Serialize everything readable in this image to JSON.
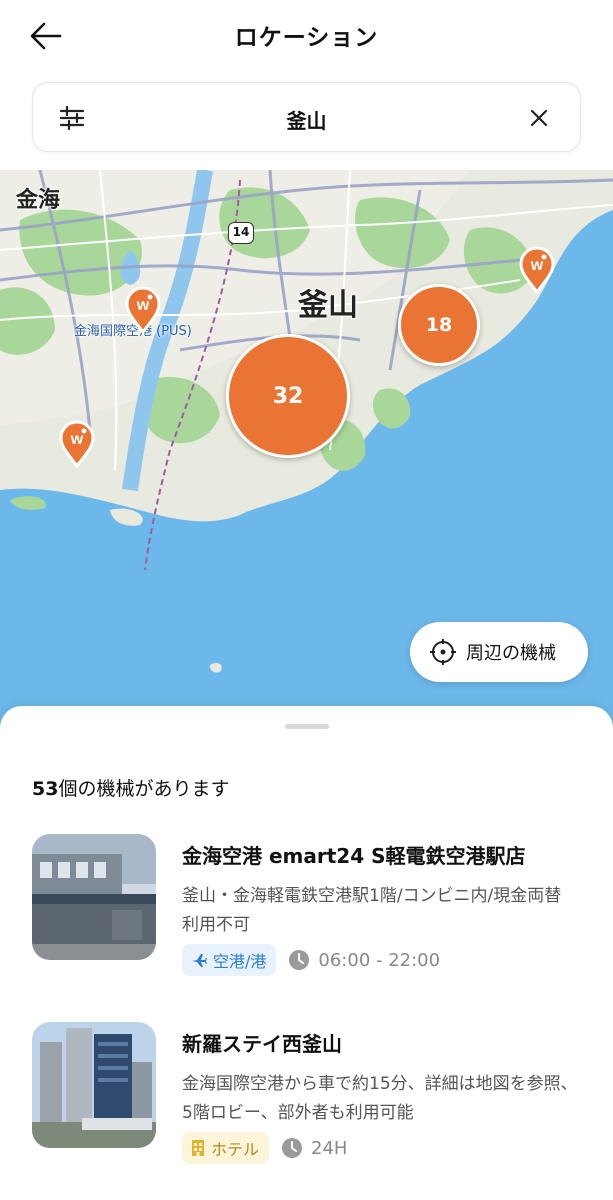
{
  "header": {
    "title": "ロケーション",
    "back_icon": "arrow-left-icon"
  },
  "search": {
    "value": "釜山",
    "filter_icon": "sliders-icon",
    "clear_icon": "close-icon"
  },
  "map": {
    "city_labels": {
      "gimhae": "金海",
      "busan": "釜山"
    },
    "airport_label": "金海国際空港 (PUS)",
    "route_number": "14",
    "clusters": [
      {
        "count": "32"
      },
      {
        "count": "18"
      }
    ],
    "pin_icon": "machine-pin-icon",
    "nearby_button": {
      "label": "周辺の機械",
      "icon": "crosshair-icon"
    },
    "colors": {
      "cluster": "#ea7433",
      "sea": "#6cb8ea",
      "land": "#e8eadf",
      "green": "#a9d79a"
    }
  },
  "results": {
    "count": "53",
    "count_suffix": "個の機械があります",
    "items": [
      {
        "title": "金海空港 emart24 S軽電鉄空港駅店",
        "description": "釜山・金海軽電鉄空港駅1階/コンビニ内/現金両替 利用不可",
        "tag": "空港/港",
        "tag_icon": "airplane-icon",
        "hours": "06:00 - 22:00",
        "hours_icon": "clock-icon"
      },
      {
        "title": "新羅ステイ西釜山",
        "description": "金海国際空港から車で約15分、詳細は地図を参照、5階ロビー、部外者も利用可能",
        "tag": "ホテル",
        "tag_icon": "building-icon",
        "hours": "24H",
        "hours_icon": "clock-icon"
      }
    ]
  }
}
